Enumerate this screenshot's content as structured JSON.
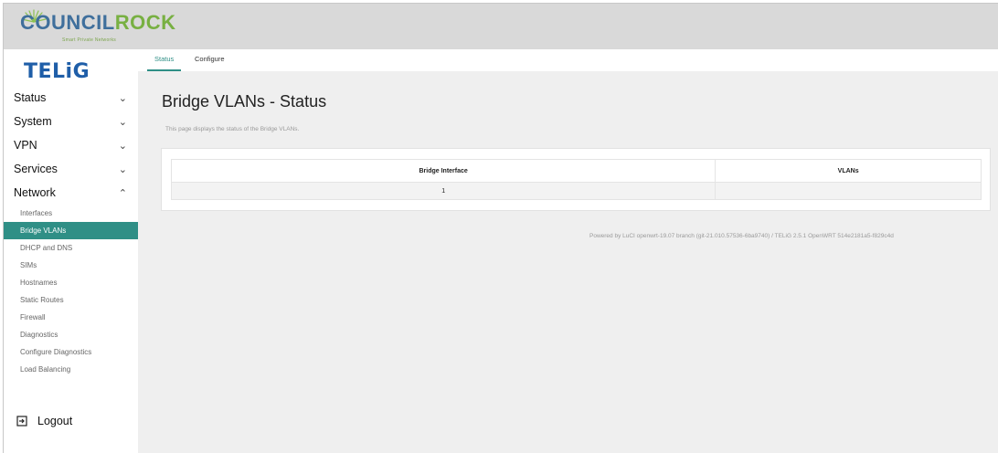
{
  "banner": {
    "logo_part1": "COUNCIL",
    "logo_part2": "ROCK",
    "tagline": "Smart Private Networks"
  },
  "sidebar": {
    "brand": "TELiG",
    "menu": [
      {
        "label": "Status",
        "chevron": "chevron-down-icon"
      },
      {
        "label": "System",
        "chevron": "chevron-down-icon"
      },
      {
        "label": "VPN",
        "chevron": "chevron-down-icon"
      },
      {
        "label": "Services",
        "chevron": "chevron-down-icon"
      },
      {
        "label": "Network",
        "chevron": "chevron-up-icon"
      }
    ],
    "network_items": [
      "Interfaces",
      "Bridge VLANs",
      "DHCP and DNS",
      "SIMs",
      "Hostnames",
      "Static Routes",
      "Firewall",
      "Diagnostics",
      "Configure Diagnostics",
      "Load Balancing"
    ],
    "active_item": "Bridge VLANs",
    "logout": "Logout"
  },
  "tabs": {
    "status": "Status",
    "configure": "Configure"
  },
  "page": {
    "title": "Bridge VLANs - Status",
    "description": "This page displays the status of the Bridge VLANs."
  },
  "table": {
    "headers": [
      "Bridge Interface",
      "VLANs"
    ],
    "rows": [
      [
        "1",
        ""
      ]
    ]
  },
  "footer": "Powered by LuCI openwrt-19.07 branch (git-21.010.57536-6ba9740) / TELiG 2.5.1 OpenWRT 514e2181a5-f829c4d",
  "colors": {
    "accent": "#2f8f86",
    "banner_bg": "#d9d9d9",
    "main_bg": "#efefef",
    "brand": "#1f5ea8"
  }
}
